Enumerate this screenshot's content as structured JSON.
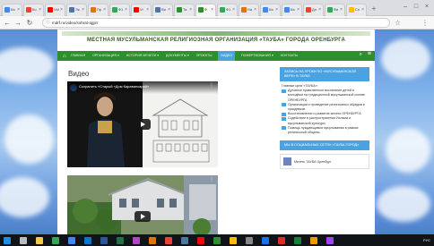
{
  "browser": {
    "tabs": [
      {
        "label": "Ка",
        "color": "#4285f4",
        "active": false
      },
      {
        "label": "Ко",
        "color": "#ea4335",
        "active": false
      },
      {
        "label": "Vid",
        "color": "#ff0000",
        "active": false
      },
      {
        "label": "Эк",
        "color": "#4a76a8",
        "active": false
      },
      {
        "label": "Пр",
        "color": "#e37400",
        "active": false
      },
      {
        "label": "Ф1",
        "color": "#34a853",
        "active": false
      },
      {
        "label": "Vi",
        "color": "#ff0000",
        "active": false
      },
      {
        "label": "Ви",
        "color": "#4a76a8",
        "active": false
      },
      {
        "label": "Ta",
        "color": "#2f8f2f",
        "active": false
      },
      {
        "label": "Ф",
        "color": "#2f8f2f",
        "active": true
      },
      {
        "label": "Ф1",
        "color": "#34a853",
        "active": false
      },
      {
        "label": "На",
        "color": "#e37400",
        "active": false
      },
      {
        "label": "Ка",
        "color": "#4285f4",
        "active": false
      },
      {
        "label": "Ка",
        "color": "#4285f4",
        "active": false
      },
      {
        "label": "Дл",
        "color": "#ea4335",
        "active": false
      },
      {
        "label": "Фи",
        "color": "#34a853",
        "active": false
      },
      {
        "label": "Cn",
        "color": "#fbbc05",
        "active": false
      }
    ],
    "new_tab_glyph": "+",
    "window_controls": [
      "–",
      "□",
      "×"
    ],
    "url": "mdrf.ru/video/sohrat-ajgirr",
    "back_glyph": "←",
    "forward_glyph": "→",
    "reload_glyph": "↻",
    "star_glyph": "☆",
    "menu_glyph": "⋮",
    "lock_glyph": "ⓘ"
  },
  "site": {
    "title": "МЕСТНАЯ МУСУЛЬМАНСКАЯ РЕЛИГИОЗНАЯ ОРГАНИЗАЦИЯ «ТАУБА» ГОРОДА ОРЕНБУРГА",
    "nav": {
      "home_glyph": "⌂",
      "items": [
        {
          "label": "ГЛАВНАЯ",
          "active": false
        },
        {
          "label": "ОРГАНИЗАЦИЯ ▾",
          "active": false
        },
        {
          "label": "ИСТОРИЯ МЕЧЕТИ ▾",
          "active": false
        },
        {
          "label": "ДОКУМЕНТЫ ▾",
          "active": false
        },
        {
          "label": "ПРОЕКТЫ",
          "active": false
        },
        {
          "label": "ВИДЕО",
          "active": true
        },
        {
          "label": "ПОЖЕРТВОВАНИЯ ▾",
          "active": false
        },
        {
          "label": "КОНТАКТЫ",
          "active": false
        }
      ],
      "search_glyph": "⌕",
      "burger_glyph": "≡"
    },
    "content": {
      "title": "Видео",
      "videos": [
        {
          "caption": "Сохранить «Старый «Дом Каравансарай»",
          "menu_glyph": "⋮"
        },
        {
          "caption": "",
          "menu_glyph": "⋮"
        }
      ]
    },
    "sidebar": {
      "widget1_text": "ЗАПИСЬ НА УРОКИ ПО «МУСУЛЬМАНСКОЙ ВЕРЕ» В ТАУБЕ",
      "list_intro": "Главные цели «ТАУБА»:",
      "list_items": [
        "Духовное нравственное воспитание детей и молодёжи на традиционной мусульманской основе ОРЕНБУРГА",
        "Организация и проведение религиозных обрядов и праздников",
        "Восстановление и развитие мечети ОРЕНБУРГА",
        "Содействие в распространении Ислама и мусульманской культуры",
        "Помощь нуждающимся мусульманам в рамках религиозной общины"
      ],
      "widget2_text": "МЫ В СОЦИАЛЬНЫХ СЕТЯХ «ТАУБА ГОРОД»",
      "fb_name": "Мечеть ТАУБА Оренбург"
    }
  },
  "taskbar": {
    "icons": [
      "start",
      "search",
      "explorer",
      "chrome",
      "store",
      "mail",
      "word",
      "excel",
      "photos",
      "app1",
      "app2",
      "app3",
      "app4",
      "app5",
      "app6",
      "app7",
      "app8",
      "app9",
      "app10",
      "app11",
      "app12"
    ],
    "icon_colors": [
      "#1f8fe0",
      "#bbbbbb",
      "#f2c94c",
      "#34a853",
      "#4285f4",
      "#0078d4",
      "#2b579a",
      "#217346",
      "#b146c2",
      "#e37400",
      "#ea4335",
      "#4a76a8",
      "#ff0000",
      "#2f8f2f",
      "#fbbc05",
      "#888888",
      "#1a73e8",
      "#d93025",
      "#188038",
      "#f29900",
      "#a142f4"
    ],
    "tray_text": "РУС"
  }
}
